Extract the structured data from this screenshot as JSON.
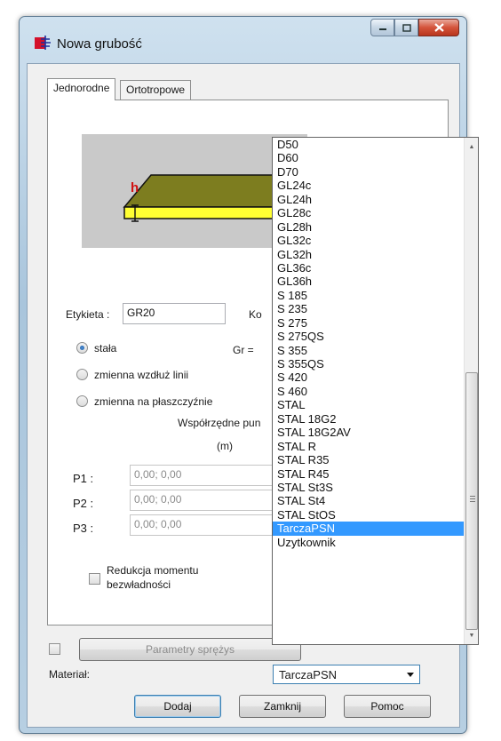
{
  "window": {
    "title": "Nowa grubość"
  },
  "tabs": [
    {
      "label": "Jednorodne",
      "active": true
    },
    {
      "label": "Ortotropowe",
      "active": false
    }
  ],
  "preview": {
    "h_label": "h"
  },
  "form": {
    "etykieta_label": "Etykieta :",
    "etykieta_value": "GR20",
    "ko_label": "Ko",
    "gr_label": "Gr =",
    "radio_stala": "stała",
    "radio_linia": "zmienna wzdłuż linii",
    "radio_plaszczyzna": "zmienna na płaszczyźnie",
    "coords_header": "Współrzędne pun",
    "coords_unit": "(m)",
    "points": [
      {
        "label": "P1 :",
        "value": "0,00; 0,00"
      },
      {
        "label": "P2 :",
        "value": "0,00; 0,00"
      },
      {
        "label": "P3 :",
        "value": "0,00; 0,00"
      }
    ],
    "reduction_line1": "Redukcja momentu",
    "reduction_line2": "bezwładności",
    "params_button": "Parametry sprężys",
    "material_label": "Materiał:",
    "material_value": "TarczaPSN"
  },
  "dropdown": {
    "items": [
      "D50",
      "D60",
      "D70",
      "GL24c",
      "GL24h",
      "GL28c",
      "GL28h",
      "GL32c",
      "GL32h",
      "GL36c",
      "GL36h",
      "S 185",
      "S 235",
      "S 275",
      "S 275QS",
      "S 355",
      "S 355QS",
      "S 420",
      "S 460",
      "STAL",
      "STAL 18G2",
      "STAL 18G2AV",
      "STAL R",
      "STAL R35",
      "STAL R45",
      "STAL St3S",
      "STAL St4",
      "STAL StOS",
      "TarczaPSN",
      "Uzytkownik"
    ],
    "selected": "TarczaPSN"
  },
  "buttons": {
    "dodaj": "Dodaj",
    "zamknij": "Zamknij",
    "pomoc": "Pomoc"
  },
  "colors": {
    "selection": "#3399ff",
    "slab_top": "#7d7d1f",
    "slab_bottom": "#ffff33",
    "h_label": "#d01010"
  }
}
